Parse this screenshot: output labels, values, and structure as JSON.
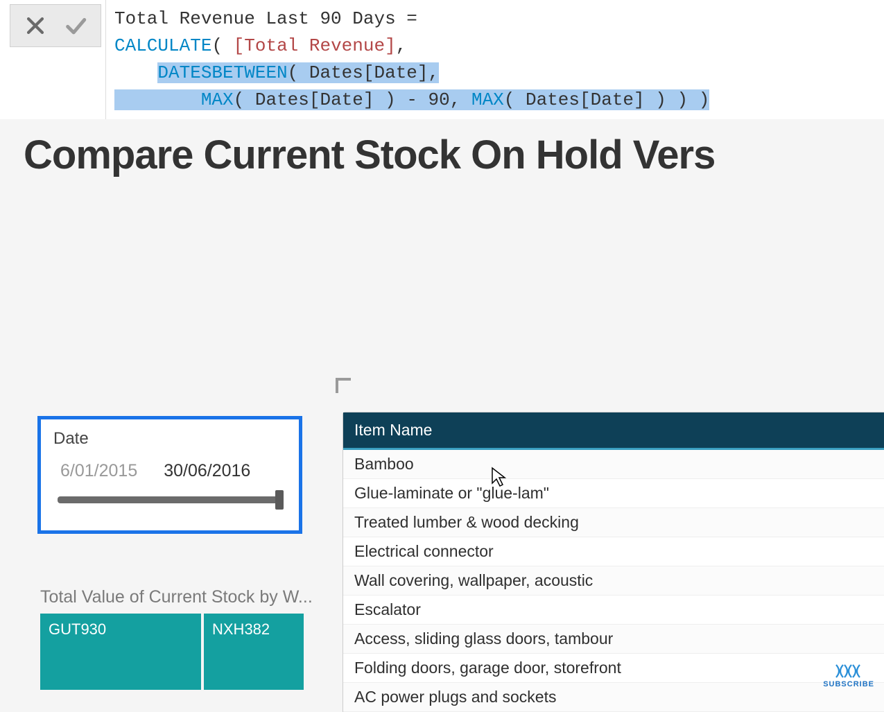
{
  "formula": {
    "line1_plain": "Total Revenue Last 90 Days =",
    "calc": "CALCULATE",
    "measure": "[Total Revenue]",
    "datesbetween": "DATESBETWEEN",
    "dates_date": "Dates[Date]",
    "max": "MAX",
    "minus90": "- 90",
    "comma": ",",
    "open": "(",
    "close": ")"
  },
  "page_title": "Compare Current Stock On Hold Vers",
  "slicer": {
    "title": "Date",
    "start": "6/01/2015",
    "end": "30/06/2016"
  },
  "treemap": {
    "title": "Total Value of Current Stock by W...",
    "cells": [
      "GUT930",
      "NXH382"
    ]
  },
  "table": {
    "header": "Item Name",
    "rows": [
      "Bamboo",
      "Glue-laminate or \"glue-lam\"",
      "Treated lumber & wood decking",
      "Electrical connector",
      "Wall covering, wallpaper, acoustic",
      "Escalator",
      "Access, sliding glass doors, tambour",
      "Folding doors, garage door, storefront",
      "AC power plugs and sockets"
    ]
  },
  "subscribe_label": "SUBSCRIBE"
}
